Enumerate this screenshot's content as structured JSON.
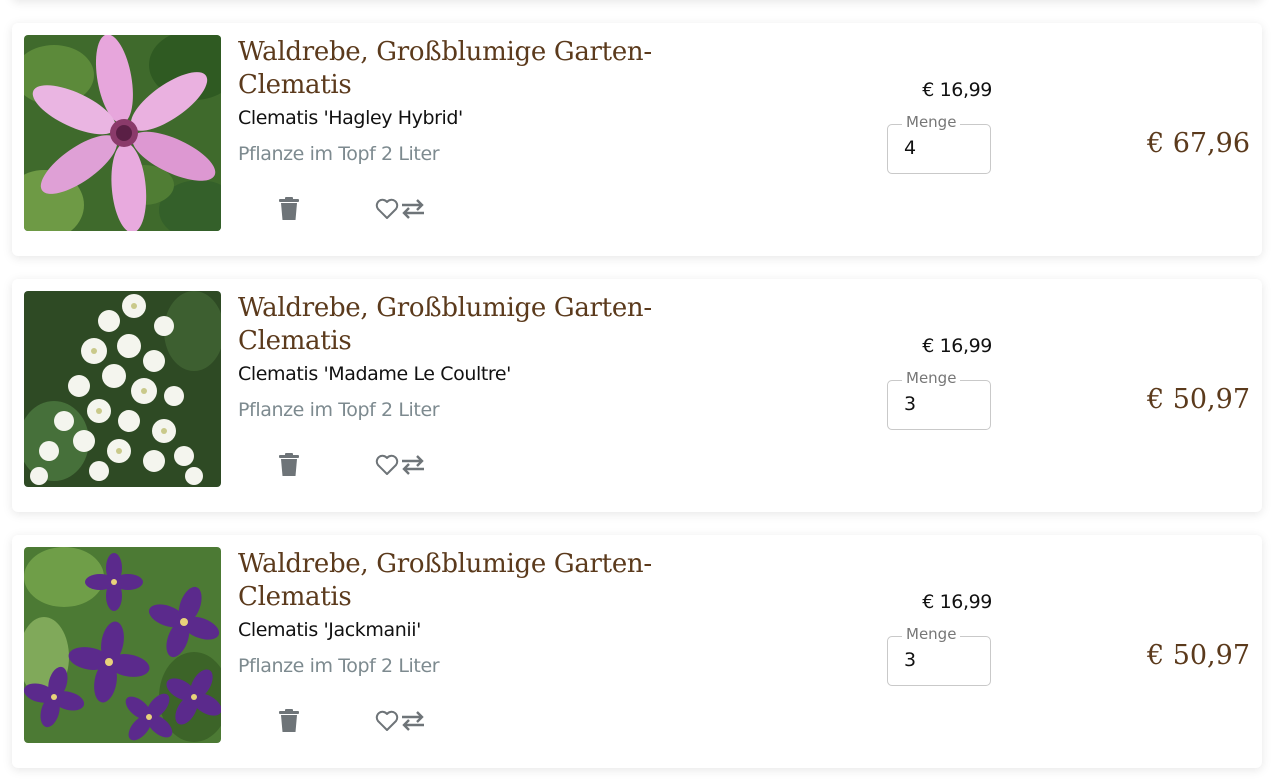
{
  "currency_symbol": "€",
  "colors": {
    "title_brown": "#5b3a1c",
    "muted_gray": "#7d8a8f",
    "icon_gray": "#6e7478"
  },
  "cart_items": [
    {
      "name": "Waldrebe, Großblumige Garten-Clematis",
      "variety": "Clematis 'Hagley Hybrid'",
      "pot_size": "Pflanze im Topf 2 Liter",
      "unit_price": "€ 16,99",
      "quantity_label": "Menge",
      "quantity": "4",
      "line_total": "€ 67,96",
      "image_icon": "pink-clematis-photo",
      "actions": [
        "trash-icon",
        "heart-icon",
        "swap-icon"
      ]
    },
    {
      "name": "Waldrebe, Großblumige Garten-Clematis",
      "variety": "Clematis 'Madame Le Coultre'",
      "pot_size": "Pflanze im Topf 2 Liter",
      "unit_price": "€ 16,99",
      "quantity_label": "Menge",
      "quantity": "3",
      "line_total": "€ 50,97",
      "image_icon": "white-clematis-photo",
      "actions": [
        "trash-icon",
        "heart-icon",
        "swap-icon"
      ]
    },
    {
      "name": "Waldrebe, Großblumige Garten-Clematis",
      "variety": "Clematis 'Jackmanii'",
      "pot_size": "Pflanze im Topf 2 Liter",
      "unit_price": "€ 16,99",
      "quantity_label": "Menge",
      "quantity": "3",
      "line_total": "€ 50,97",
      "image_icon": "purple-clematis-photo",
      "actions": [
        "trash-icon",
        "heart-icon",
        "swap-icon"
      ]
    }
  ]
}
